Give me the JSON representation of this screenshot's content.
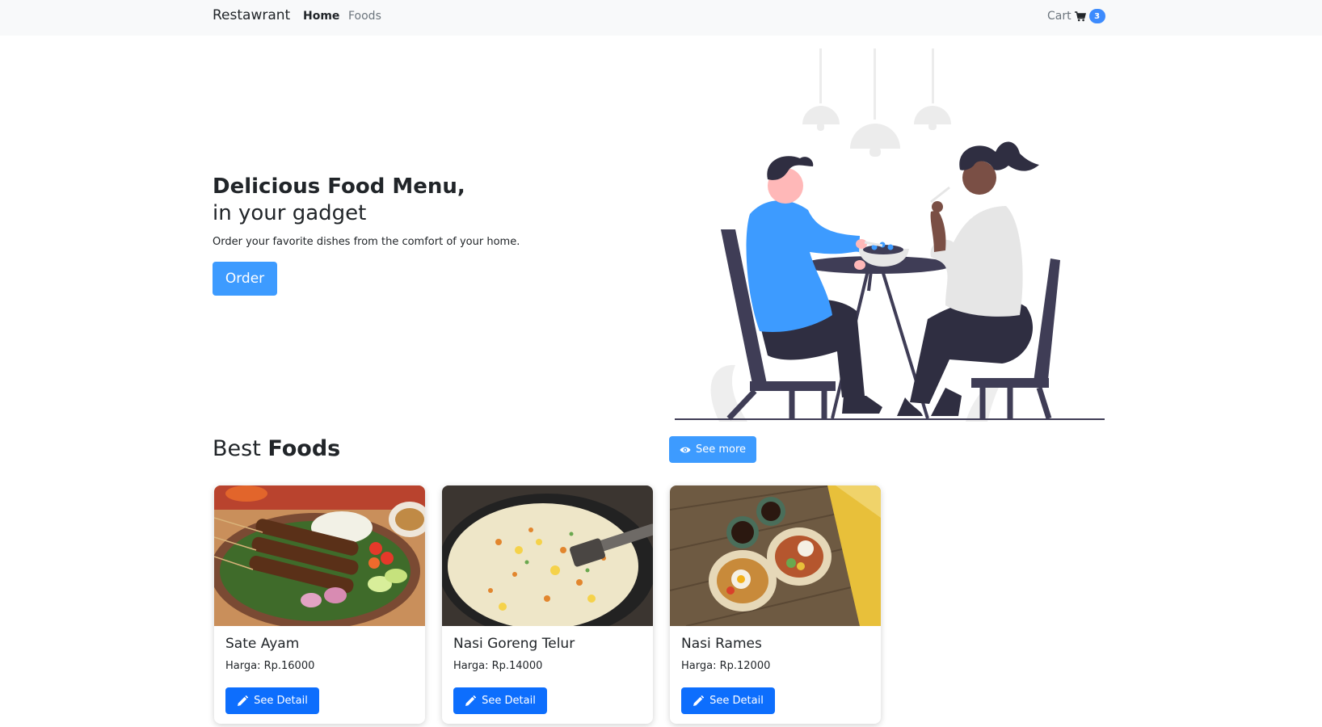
{
  "navbar": {
    "brand": "Restawrant",
    "links": [
      {
        "label": "Home",
        "active": true
      },
      {
        "label": "Foods",
        "active": false
      }
    ],
    "cart_label": "Cart",
    "cart_icon": "cart-icon",
    "cart_count": "3"
  },
  "hero": {
    "title": "Delicious Food Menu,",
    "subtitle": "in your gadget",
    "description": "Order your favorite dishes from the comfort of your home.",
    "order_label": "Order",
    "illustration": "couple-dining-illustration"
  },
  "best_foods": {
    "title_light": "Best",
    "title_bold": "Foods",
    "see_more_label": "See more",
    "see_more_icon": "eye-icon",
    "items": [
      {
        "name": "Sate Ayam",
        "price": "Harga: Rp.16000",
        "button": "See Detail",
        "icon": "pencil-icon",
        "image": "sate-ayam-photo"
      },
      {
        "name": "Nasi Goreng Telur",
        "price": "Harga: Rp.14000",
        "button": "See Detail",
        "icon": "pencil-icon",
        "image": "nasi-goreng-photo"
      },
      {
        "name": "Nasi Rames",
        "price": "Harga: Rp.12000",
        "button": "See Detail",
        "icon": "pencil-icon",
        "image": "nasi-rames-photo"
      }
    ]
  },
  "colors": {
    "accent": "#3d9bff",
    "primary": "#0d6efd",
    "navbar_bg": "#f8f9fa",
    "text": "#212529"
  }
}
